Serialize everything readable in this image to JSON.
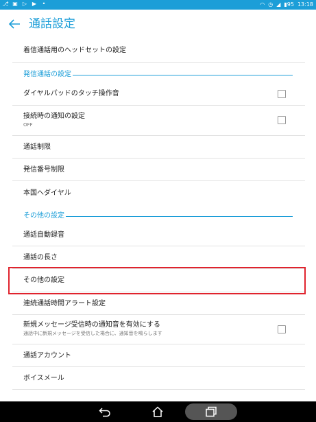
{
  "status_bar": {
    "left_icons": [
      "usb-icon",
      "image-icon",
      "play-icon",
      "play-store-icon",
      "dot-icon"
    ],
    "right_icons": [
      "wifi-icon",
      "alarm-icon",
      "signal-icon",
      "battery-icon"
    ],
    "battery": "95",
    "time": "13:18"
  },
  "header": {
    "title": "通話設定"
  },
  "items": {
    "headset": {
      "label": "着信通話用のヘッドセットの設定"
    },
    "section_outgoing": {
      "label": "発信通話の設定"
    },
    "dialpad_tone": {
      "label": "ダイヤルパッドのタッチ操作音",
      "checked": false
    },
    "connect_notify": {
      "label": "接続時の通知の設定",
      "sub": "OFF",
      "checked": false
    },
    "call_barring": {
      "label": "通話制限"
    },
    "fdn": {
      "label": "発信番号制限"
    },
    "home_dial": {
      "label": "本国へダイヤル"
    },
    "section_other": {
      "label": "その他の設定"
    },
    "auto_record": {
      "label": "通話自動録音"
    },
    "call_duration": {
      "label": "通話の長さ"
    },
    "other_settings": {
      "label": "その他の設定"
    },
    "continuous_alert": {
      "label": "連続通話時間アラート設定"
    },
    "sms_alert": {
      "label": "新規メッセージ受信時の通知音を有効にする",
      "sub": "通話中に新規メッセージを受信した場合に、通知音を鳴らします",
      "checked": false
    },
    "call_account": {
      "label": "通話アカウント"
    },
    "voicemail": {
      "label": "ボイスメール"
    }
  },
  "nav_bar": {
    "icons": [
      "back-icon",
      "home-icon",
      "recent-apps-icon"
    ]
  },
  "colors": {
    "accent": "#1c9ed8",
    "highlight": "#e0232d",
    "status_bar": "#1c9ed8",
    "nav_bar": "#000000"
  }
}
